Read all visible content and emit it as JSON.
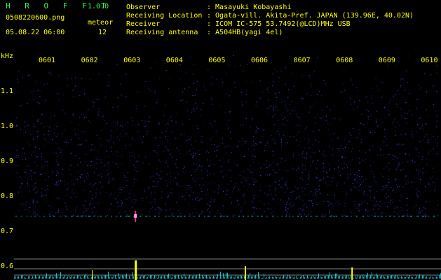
{
  "app": {
    "name": "H R O F F T",
    "version": "1.0.0",
    "filename": "0508220600.png",
    "datetime": "05.08.22 06:00",
    "meteor_label": "meteor",
    "meteor_count": "12"
  },
  "info": [
    {
      "label": "Observer",
      "value": ": Masayuki Kobayashi"
    },
    {
      "label": "Receiving Location",
      "value": ": Ogata-vill. Akita-Pref. JAPAN (139.96E, 40.02N)"
    },
    {
      "label": "Receiver",
      "value": ": ICOM IC-575 53.7492(@LCD)MHz USB"
    },
    {
      "label": "Receiving antenna",
      "value": ": A504HB(yagi 4el)"
    }
  ],
  "chart_data": {
    "type": "heatmap",
    "y_unit": "kHz",
    "y_ticks": [
      "1.1",
      "1.0",
      "0.9",
      "0.8",
      "0.7",
      "0.6"
    ],
    "x_ticks": [
      "0601",
      "0602",
      "0603",
      "0604",
      "0605",
      "0606",
      "0607",
      "0608",
      "0609",
      "0610"
    ],
    "carrier_khz": 0.74,
    "meteor_echo_minute": "0603",
    "colors": {
      "background": "#000000",
      "noise": "#3a40d0",
      "carrier": "#00e6ff",
      "echo": "#ff3366",
      "text": "#ffff00",
      "title": "#33ff55",
      "count_bars": "#ffff00",
      "baseline": "#00e6ff",
      "grid_lines": "#808080"
    }
  }
}
